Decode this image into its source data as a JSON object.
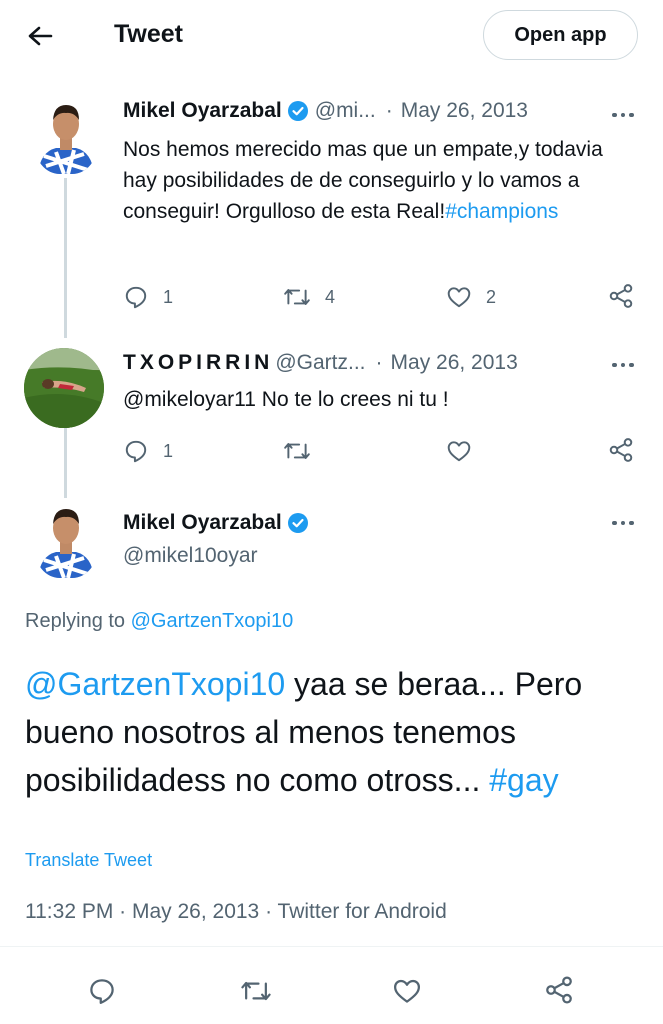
{
  "header": {
    "title": "Tweet",
    "open_app_label": "Open app"
  },
  "tweet1": {
    "name": "Mikel Oyarzabal",
    "handle": "@mi...",
    "date": "May 26, 2013",
    "text": "Nos hemos merecido mas que un empate,y todavia hay posibilidades de de conseguirlo y lo vamos a conseguir! Orgulloso de esta Real!",
    "hashtag": "#champions",
    "reply_count": "1",
    "retweet_count": "4",
    "like_count": "2"
  },
  "tweet2": {
    "name": "TXOPIRRIN",
    "handle": "@Gartz...",
    "date": "May 26, 2013",
    "text": "@mikeloyar11 No te lo crees ni tu !",
    "reply_count": "1"
  },
  "main_tweet": {
    "name": "Mikel Oyarzabal",
    "handle": "@mikel10oyar",
    "replying_prefix": "Replying to ",
    "replying_handle": "@GartzenTxopi10",
    "mention": "@GartzenTxopi10",
    "body": " yaa se beraa... Pero bueno nosotros al menos tenemos posibilidadess no como otross... ",
    "hashtag": "#gay",
    "translate": "Translate Tweet",
    "meta": "11:32 PM · May 26, 2013 · Twitter for Android"
  },
  "colors": {
    "link": "#1d9bf0",
    "verified": "#1d9bf0",
    "secondary_text": "#536471"
  },
  "icons": [
    "back-arrow-icon",
    "verified-icon",
    "more-icon",
    "reply-icon",
    "retweet-icon",
    "like-icon",
    "share-icon"
  ]
}
